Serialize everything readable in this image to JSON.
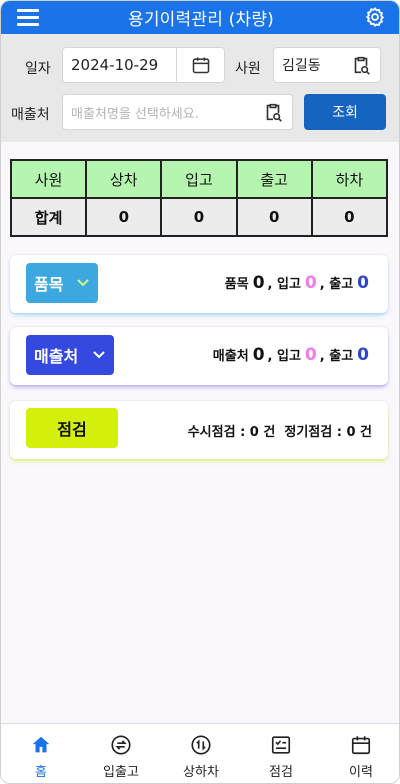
{
  "header": {
    "title": "용기이력관리 (차량)",
    "menu_icon": "hamburger-menu-icon",
    "settings_icon": "gear-icon"
  },
  "filters": {
    "date_label": "일자",
    "date_value": "2024-10-29",
    "employee_label": "사원",
    "employee_value": "김길동",
    "customer_label": "매출처",
    "customer_placeholder": "매출처명을 선택하세요.",
    "search_button": "조회"
  },
  "summary": {
    "headers": [
      "사원",
      "상차",
      "입고",
      "출고",
      "하차"
    ],
    "row": [
      "합계",
      "0",
      "0",
      "0",
      "0"
    ]
  },
  "cards": {
    "item": {
      "button": "품목",
      "label1": "품목",
      "value1": "0",
      "label2": "입고",
      "value2": "0",
      "label3": "출고",
      "value3": "0"
    },
    "customer": {
      "button": "매출처",
      "label1": "매출처",
      "value1": "0",
      "label2": "입고",
      "value2": "0",
      "label3": "출고",
      "value3": "0"
    },
    "inspection": {
      "button": "점검",
      "text": "수시점검 : 0 건  정기점검 : 0 건"
    }
  },
  "nav": [
    {
      "label": "홈",
      "icon": "home-icon",
      "active": true
    },
    {
      "label": "입출고",
      "icon": "exchange-icon",
      "active": false
    },
    {
      "label": "상하차",
      "icon": "updown-icon",
      "active": false
    },
    {
      "label": "점검",
      "icon": "checklist-icon",
      "active": false
    },
    {
      "label": "이력",
      "icon": "calendar-icon",
      "active": false
    }
  ],
  "colors": {
    "primary": "#1a73e8",
    "search_button": "#1565c0",
    "table_header": "#b6f5b0",
    "item_pill": "#3da8e0",
    "customer_pill": "#3548e0",
    "inspection_pill": "#d4f00a",
    "in_value": "#f07ce6",
    "out_value": "#2e45c8"
  }
}
